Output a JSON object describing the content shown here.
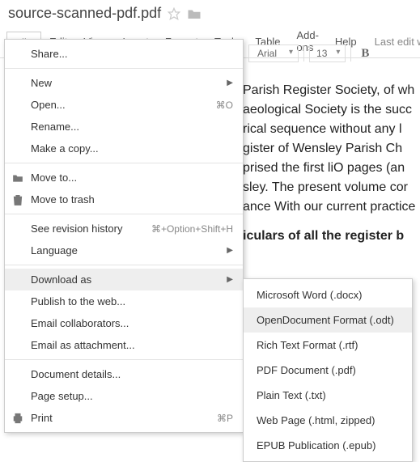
{
  "doc_title": "source-scanned-pdf.pdf",
  "menubar": {
    "items": [
      "File",
      "Edit",
      "View",
      "Insert",
      "Format",
      "Tools",
      "Table",
      "Add-ons",
      "Help"
    ],
    "last_edit": "Last edit was"
  },
  "toolbar": {
    "font": "Arial",
    "size": "13",
    "bold": "B"
  },
  "document_body": {
    "p1_l1": "Parish Register Society, of wh",
    "p1_l2": "aeological Society is the succ",
    "p1_l3": "rical sequence without any l",
    "p1_l4": "gister of Wensley Parish Ch",
    "p1_l5": "prised the first liO pages (an",
    "p1_l6": "sley. The present volume cor",
    "p1_l7": "ance With our current practice",
    "p2_l1": "iculars of all the register b"
  },
  "file_menu": {
    "share": "Share...",
    "new": "New",
    "open": {
      "label": "Open...",
      "shortcut": "⌘O"
    },
    "rename": "Rename...",
    "make_copy": "Make a copy...",
    "move_to": "Move to...",
    "move_to_trash": "Move to trash",
    "revision": {
      "label": "See revision history",
      "shortcut": "⌘+Option+Shift+H"
    },
    "language": "Language",
    "download_as": "Download as",
    "publish": "Publish to the web...",
    "email_collab": "Email collaborators...",
    "email_attach": "Email as attachment...",
    "doc_details": "Document details...",
    "page_setup": "Page setup...",
    "print": {
      "label": "Print",
      "shortcut": "⌘P"
    }
  },
  "download_submenu": {
    "docx": "Microsoft Word (.docx)",
    "odt": "OpenDocument Format (.odt)",
    "rtf": "Rich Text Format (.rtf)",
    "pdf": "PDF Document (.pdf)",
    "txt": "Plain Text (.txt)",
    "html": "Web Page (.html, zipped)",
    "epub": "EPUB Publication (.epub)"
  }
}
